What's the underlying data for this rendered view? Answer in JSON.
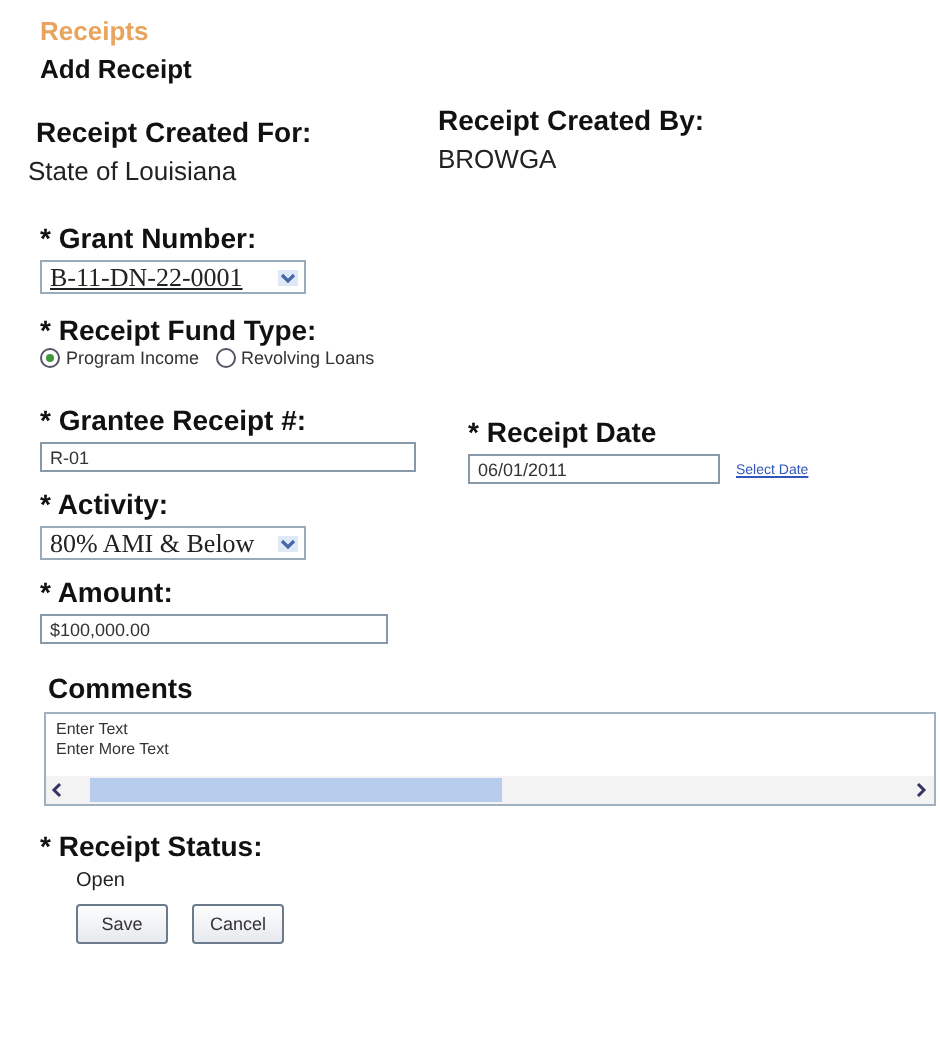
{
  "breadcrumb": "Receipts",
  "title": "Add Receipt",
  "created_for": {
    "label": "Receipt Created For:",
    "value": "State of Louisiana"
  },
  "created_by": {
    "label": "Receipt Created By:",
    "value": "BROWGA"
  },
  "grant_number": {
    "label": "* Grant Number:",
    "value": "B-11-DN-22-0001"
  },
  "fund_type": {
    "label": "* Receipt Fund Type:",
    "options": [
      {
        "label": "Program Income",
        "selected": true
      },
      {
        "label": "Revolving Loans",
        "selected": false
      }
    ]
  },
  "grantee_receipt": {
    "label": "* Grantee Receipt #:",
    "value": "R-01"
  },
  "receipt_date": {
    "label": "* Receipt Date",
    "value": "06/01/2011",
    "link": "Select Date"
  },
  "activity": {
    "label": "* Activity:",
    "value": "80% AMI & Below"
  },
  "amount": {
    "label": "* Amount:",
    "value": "$100,000.00"
  },
  "comments": {
    "label": "Comments",
    "value": "Enter Text\nEnter More Text"
  },
  "status": {
    "label": "* Receipt Status:",
    "value": "Open"
  },
  "buttons": [
    "Save",
    "Cancel"
  ]
}
